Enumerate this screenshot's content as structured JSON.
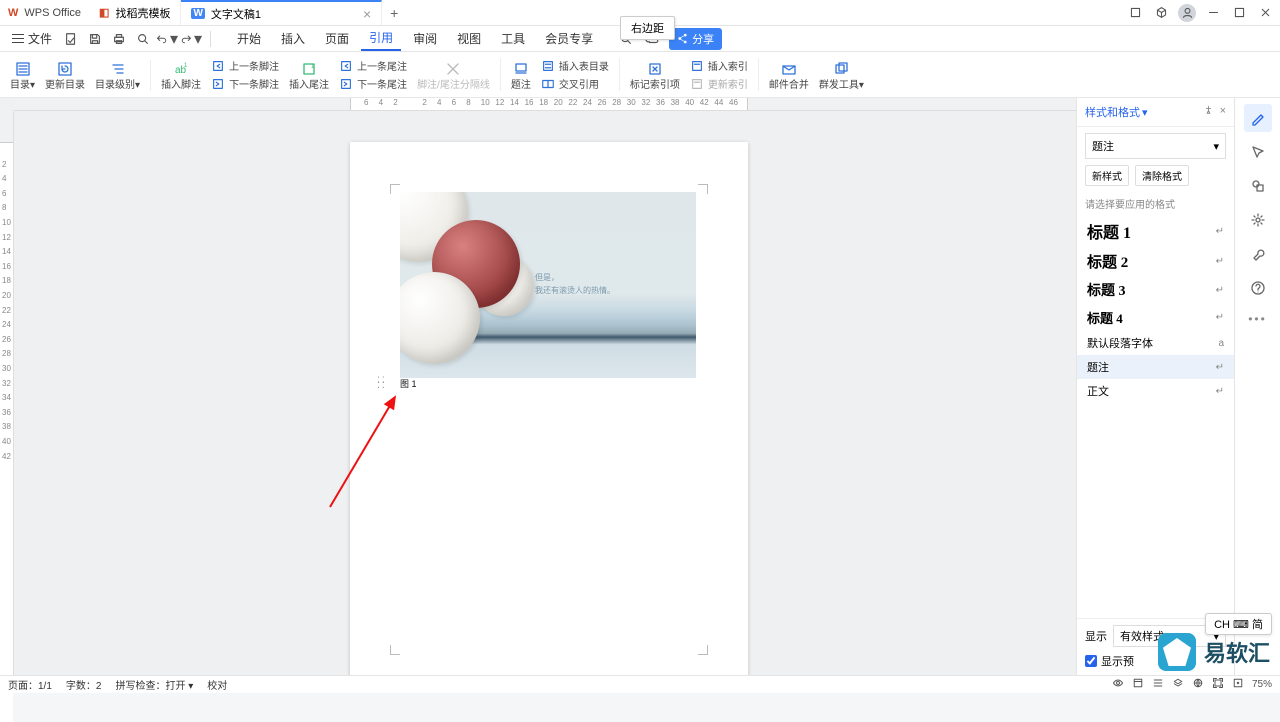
{
  "app_name": "WPS Office",
  "tabs": [
    {
      "icon": "D",
      "label": "找稻壳模板"
    },
    {
      "icon": "W",
      "label": "文字文稿1",
      "active": true,
      "close": "×"
    }
  ],
  "hover_tip": "右边距",
  "ime_tip": "CH ⌨ 简",
  "file_label": "文件",
  "menu": [
    "开始",
    "插入",
    "页面",
    "引用",
    "审阅",
    "视图",
    "工具",
    "会员专享"
  ],
  "menu_active_index": 3,
  "share_label": "分享",
  "ribbon": {
    "toc": "目录",
    "update_toc": "更新目录",
    "level": "目录级别",
    "insert_fn": "插入脚注",
    "prev_fn": "上一条脚注",
    "next_fn": "下一条脚注",
    "insert_en": "插入尾注",
    "prev_en": "上一条尾注",
    "next_en": "下一条尾注",
    "fn_sep": "脚注/尾注分隔线",
    "caption": "题注",
    "fig_toc": "插入表目录",
    "xref": "交叉引用",
    "idx_mark": "标记索引项",
    "insert_idx": "插入索引",
    "upd_idx": "更新索引",
    "mail_merge": "邮件合并",
    "group_tool": "群发工具"
  },
  "ruler_h": [
    "6",
    "4",
    "2",
    "",
    "2",
    "4",
    "6",
    "8",
    "10",
    "12",
    "14",
    "16",
    "18",
    "20",
    "22",
    "24",
    "26",
    "28",
    "30",
    "32",
    "36",
    "38",
    "40",
    "42",
    "44",
    "46"
  ],
  "ruler_v": [
    "",
    "2",
    "4",
    "6",
    "8",
    "10",
    "12",
    "14",
    "16",
    "18",
    "20",
    "22",
    "24",
    "26",
    "28",
    "30",
    "32",
    "34",
    "36",
    "38",
    "40",
    "42"
  ],
  "caption_text": "图 1",
  "doc_img_text1": "但是，",
  "doc_img_text2": "我还有滚烫人的热情。",
  "panel": {
    "title": "样式和格式",
    "select": "题注",
    "btn_new": "新样式",
    "btn_clear": "清除格式",
    "label_choose": "请选择要应用的格式",
    "styles": [
      {
        "name": "标题 1",
        "cls": "h1"
      },
      {
        "name": "标题 2",
        "cls": "h2"
      },
      {
        "name": "标题 3",
        "cls": "h3"
      },
      {
        "name": "标题 4",
        "cls": "h4"
      },
      {
        "name": "默认段落字体",
        "cls": "para",
        "mark_type": "a"
      },
      {
        "name": "题注",
        "cls": "para",
        "highlight": true
      },
      {
        "name": "正文",
        "cls": "para"
      }
    ],
    "footer_show": "显示",
    "footer_select": "有效样式",
    "footer_preview": "显示预"
  },
  "status": {
    "page": "页面：1/1",
    "words": "字数：2",
    "spell": "拼写检查：打开",
    "review": "校对",
    "zoom": "75%"
  },
  "watermark": "易软汇"
}
